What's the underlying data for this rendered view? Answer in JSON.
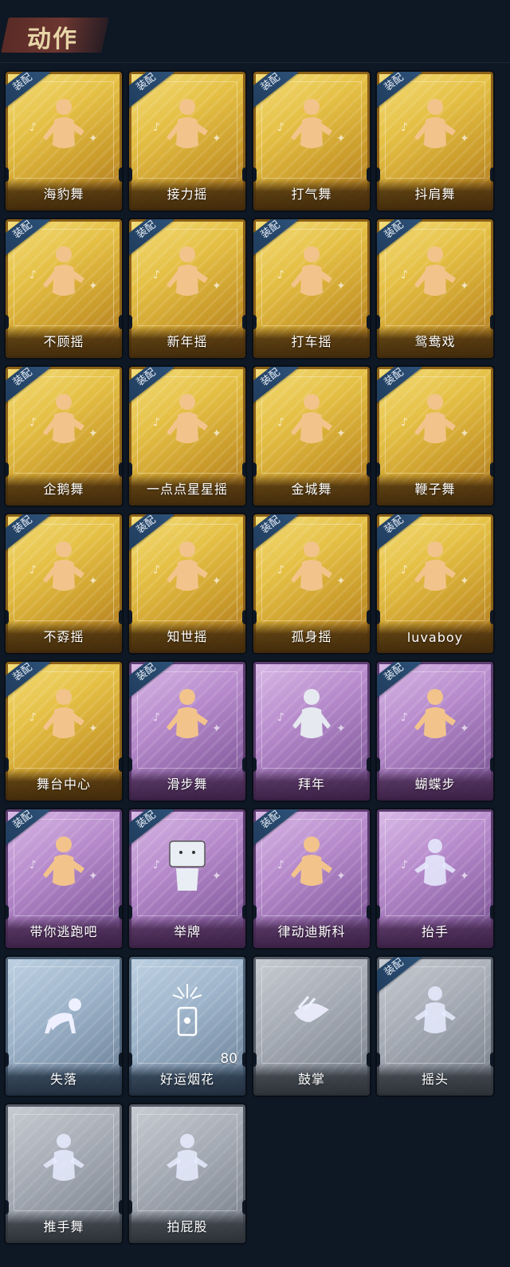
{
  "header": {
    "title": "动作"
  },
  "equip_label": "装配",
  "colors": {
    "gold": "#e5c045",
    "purple": "#b68acb",
    "blue": "#9fb5cb",
    "grey": "#a8aeb7",
    "background": "#0e1724"
  },
  "cards": [
    {
      "label": "海豹舞",
      "rarity": "gold",
      "equipped": true,
      "icon": "dance-figure-icon"
    },
    {
      "label": "接力摇",
      "rarity": "gold",
      "equipped": true,
      "icon": "dance-figure-icon"
    },
    {
      "label": "打气舞",
      "rarity": "gold",
      "equipped": true,
      "icon": "dance-figure-icon"
    },
    {
      "label": "抖肩舞",
      "rarity": "gold",
      "equipped": true,
      "icon": "dance-figure-icon"
    },
    {
      "label": "不顾摇",
      "rarity": "gold",
      "equipped": true,
      "icon": "dance-figure-icon"
    },
    {
      "label": "新年摇",
      "rarity": "gold",
      "equipped": true,
      "icon": "dance-figure-icon"
    },
    {
      "label": "打车摇",
      "rarity": "gold",
      "equipped": true,
      "icon": "dance-figure-icon"
    },
    {
      "label": "鸳鸯戏",
      "rarity": "gold",
      "equipped": true,
      "icon": "dance-figure-icon"
    },
    {
      "label": "企鹅舞",
      "rarity": "gold",
      "equipped": true,
      "icon": "dance-figure-icon"
    },
    {
      "label": "一点点星星摇",
      "rarity": "gold",
      "equipped": true,
      "icon": "dance-figure-icon"
    },
    {
      "label": "金城舞",
      "rarity": "gold",
      "equipped": true,
      "icon": "dance-figure-icon"
    },
    {
      "label": "鞭子舞",
      "rarity": "gold",
      "equipped": true,
      "icon": "dance-figure-icon"
    },
    {
      "label": "不孬摇",
      "rarity": "gold",
      "equipped": true,
      "icon": "dance-figure-icon"
    },
    {
      "label": "知世摇",
      "rarity": "gold",
      "equipped": true,
      "icon": "dance-figure-icon"
    },
    {
      "label": "孤身摇",
      "rarity": "gold",
      "equipped": true,
      "icon": "dance-figure-icon"
    },
    {
      "label": "luvaboy",
      "rarity": "gold",
      "equipped": true,
      "icon": "dance-figure-icon"
    },
    {
      "label": "舞台中心",
      "rarity": "gold",
      "equipped": true,
      "icon": "dance-figure-icon"
    },
    {
      "label": "滑步舞",
      "rarity": "purple",
      "equipped": true,
      "icon": "dance-figure-icon"
    },
    {
      "label": "拜年",
      "rarity": "purple",
      "equipped": false,
      "icon": "bow-figure-icon"
    },
    {
      "label": "蝴蝶步",
      "rarity": "purple",
      "equipped": true,
      "icon": "dance-figure-icon"
    },
    {
      "label": "带你逃跑吧",
      "rarity": "purple",
      "equipped": true,
      "icon": "dance-figure-icon"
    },
    {
      "label": "举牌",
      "rarity": "purple",
      "equipped": true,
      "icon": "sign-figure-icon"
    },
    {
      "label": "律动迪斯科",
      "rarity": "purple",
      "equipped": true,
      "icon": "dance-figure-icon"
    },
    {
      "label": "抬手",
      "rarity": "purple",
      "equipped": false,
      "icon": "raise-hand-figure-icon"
    },
    {
      "label": "失落",
      "rarity": "blue",
      "equipped": false,
      "icon": "crawl-figure-icon"
    },
    {
      "label": "好运烟花",
      "rarity": "blue",
      "equipped": false,
      "icon": "firework-icon",
      "count": "80"
    },
    {
      "label": "鼓掌",
      "rarity": "grey",
      "equipped": false,
      "icon": "clap-hands-icon"
    },
    {
      "label": "摇头",
      "rarity": "grey",
      "equipped": true,
      "icon": "shake-head-figure-icon"
    },
    {
      "label": "推手舞",
      "rarity": "grey",
      "equipped": false,
      "icon": "push-hands-figure-icon"
    },
    {
      "label": "拍屁股",
      "rarity": "grey",
      "equipped": false,
      "icon": "pat-figure-icon"
    }
  ]
}
